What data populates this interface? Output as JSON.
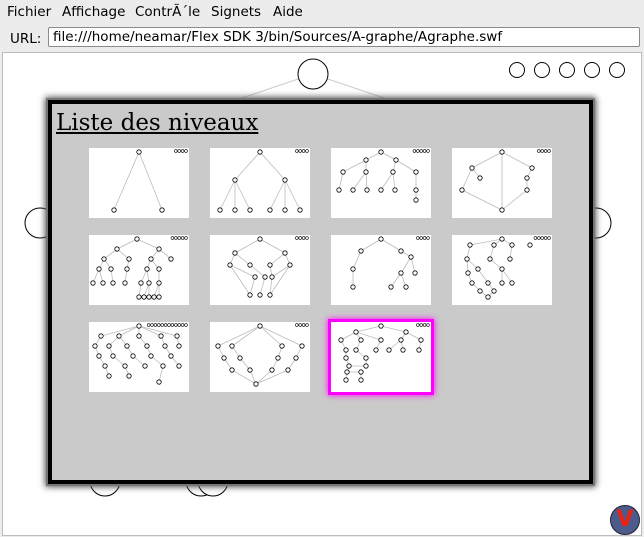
{
  "menu": {
    "items": [
      {
        "label": "Fichier"
      },
      {
        "label": "Affichage"
      },
      {
        "label": "ContrÃ´le"
      },
      {
        "label": "Signets"
      },
      {
        "label": "Aide"
      }
    ]
  },
  "urlbar": {
    "label": "URL:",
    "value": "file:///home/neamar/Flex SDK 3/bin/Sources/A-graphe/Agraphe.swf"
  },
  "dialog": {
    "title": "Liste des niveaux",
    "levels": [
      {
        "id": 1,
        "selected": false
      },
      {
        "id": 2,
        "selected": false
      },
      {
        "id": 3,
        "selected": false
      },
      {
        "id": 4,
        "selected": false
      },
      {
        "id": 5,
        "selected": false
      },
      {
        "id": 6,
        "selected": false
      },
      {
        "id": 7,
        "selected": false
      },
      {
        "id": 8,
        "selected": false
      },
      {
        "id": 9,
        "selected": false
      },
      {
        "id": 10,
        "selected": false
      },
      {
        "id": 11,
        "selected": true
      }
    ]
  },
  "logo": {
    "letter": "V",
    "color": "#e21b1b"
  },
  "colors": {
    "highlight": "#ff00ff",
    "dialog_bg": "#cacaca"
  }
}
